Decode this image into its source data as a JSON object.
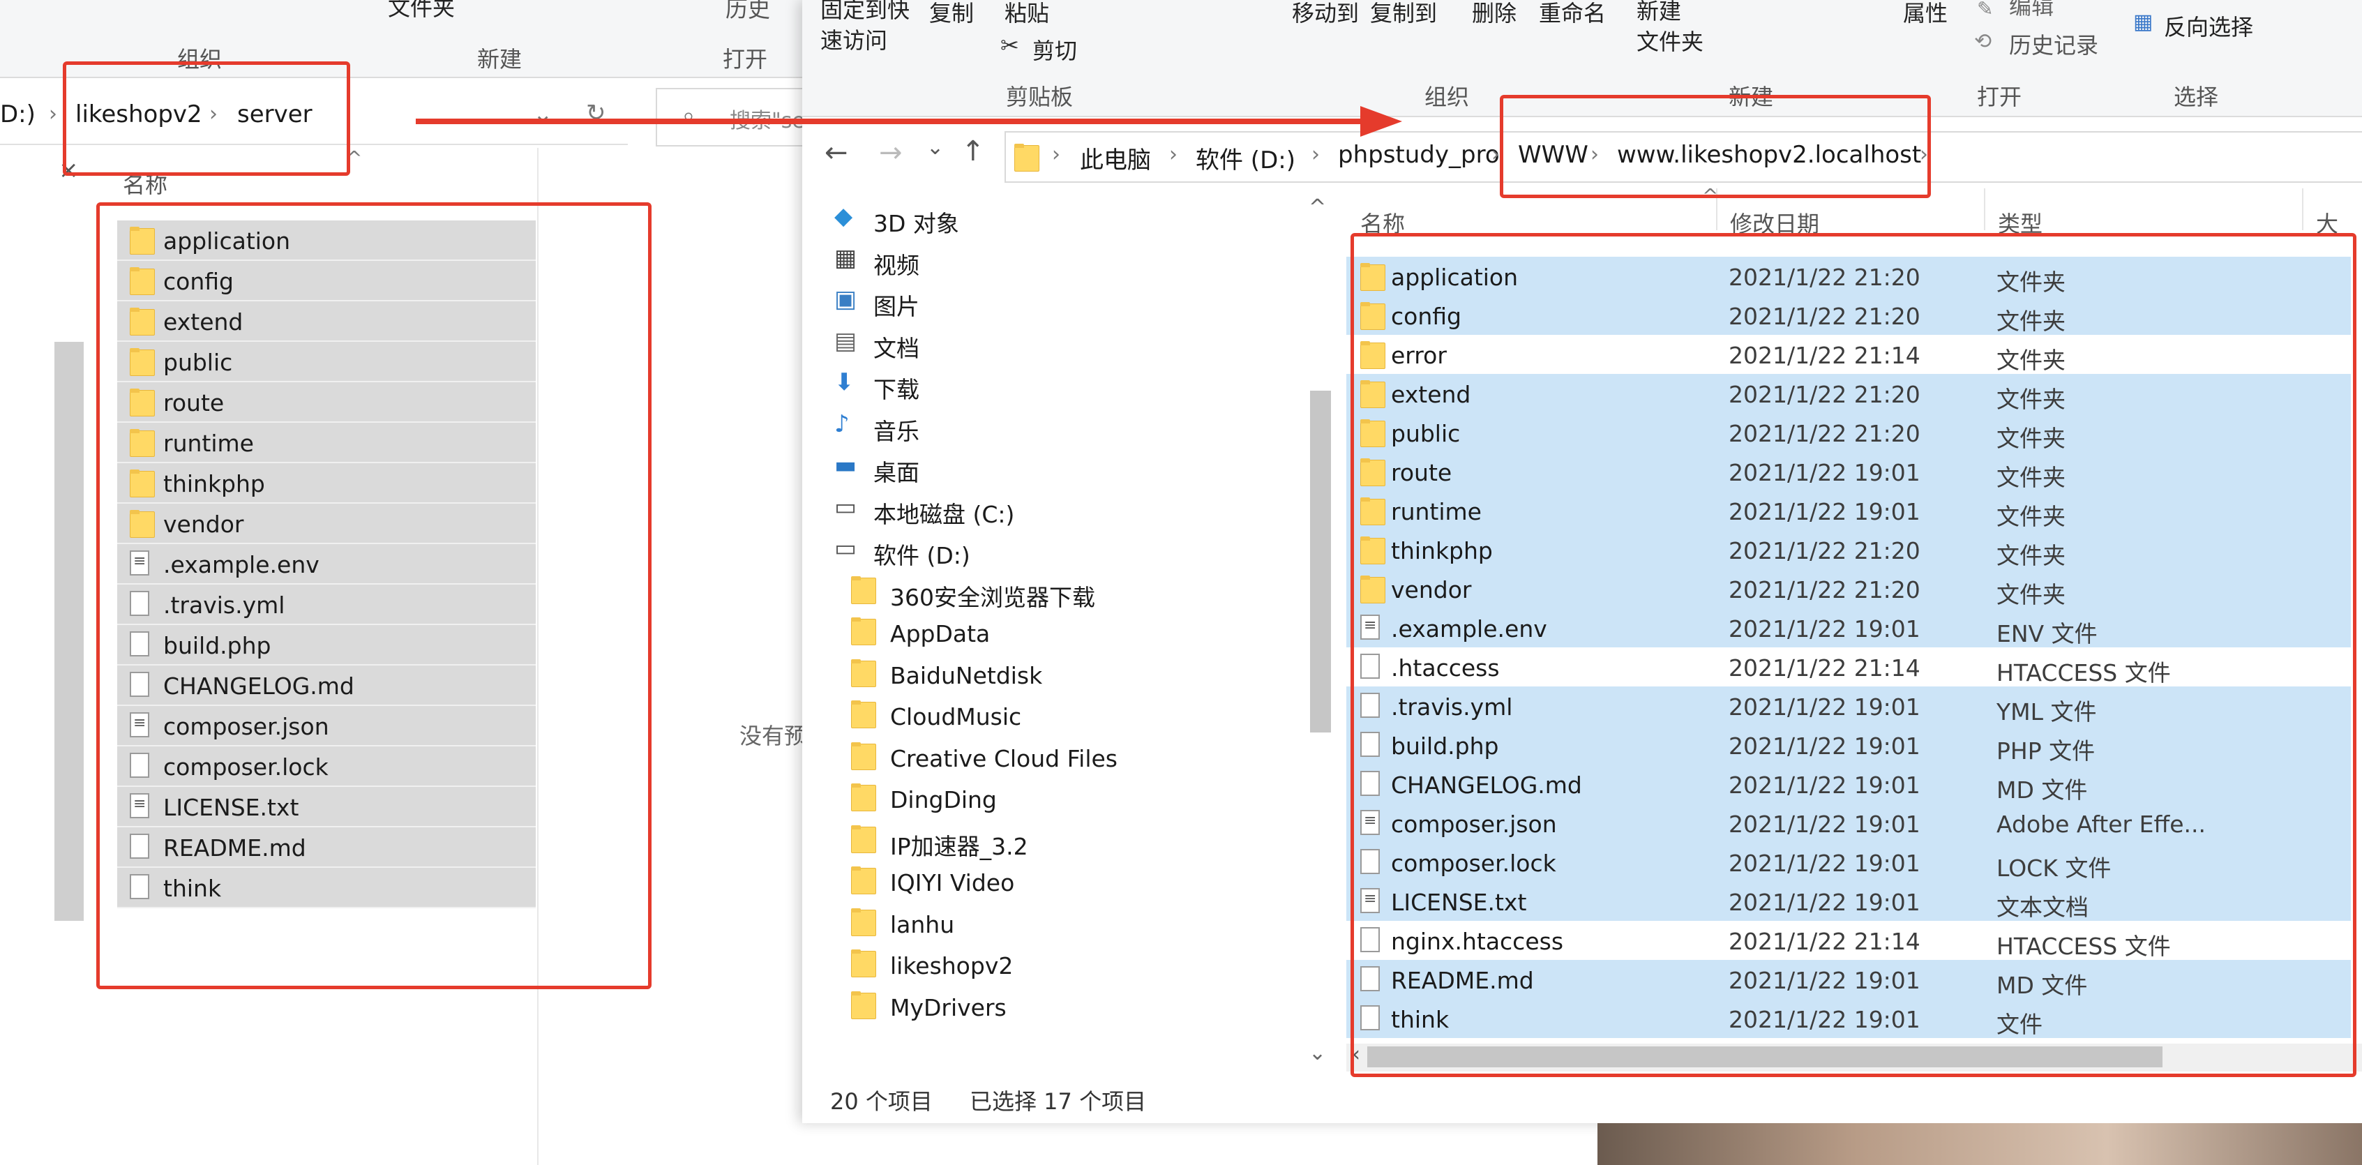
{
  "back_window": {
    "ribbon": {
      "top_cut_label": "文件夹",
      "top_cut_label2": "历史",
      "groups": [
        "组织",
        "新建",
        "打开"
      ]
    },
    "address": {
      "crumbs": [
        "D:)",
        "likeshopv2",
        "server"
      ],
      "search_placeholder": "搜索\"se"
    },
    "column_name": "名称",
    "no_preview": "没有预",
    "items": [
      {
        "name": "application",
        "icon": "folder-icon"
      },
      {
        "name": "config",
        "icon": "folder-icon"
      },
      {
        "name": "extend",
        "icon": "folder-icon"
      },
      {
        "name": "public",
        "icon": "folder-icon"
      },
      {
        "name": "route",
        "icon": "folder-icon"
      },
      {
        "name": "runtime",
        "icon": "folder-icon"
      },
      {
        "name": "thinkphp",
        "icon": "folder-icon"
      },
      {
        "name": "vendor",
        "icon": "folder-icon"
      },
      {
        "name": ".example.env",
        "icon": "settings-file-icon"
      },
      {
        "name": ".travis.yml",
        "icon": "file-icon"
      },
      {
        "name": "build.php",
        "icon": "file-icon"
      },
      {
        "name": "CHANGELOG.md",
        "icon": "file-icon"
      },
      {
        "name": "composer.json",
        "icon": "settings-file-icon"
      },
      {
        "name": "composer.lock",
        "icon": "file-icon"
      },
      {
        "name": "LICENSE.txt",
        "icon": "text-file-icon"
      },
      {
        "name": "README.md",
        "icon": "file-icon"
      },
      {
        "name": "think",
        "icon": "file-icon"
      }
    ]
  },
  "front_window": {
    "ribbon": {
      "pin": "固定到快\n速访问",
      "copy": "复制",
      "paste": "粘贴",
      "cut": "剪切",
      "clipboard_group": "剪贴板",
      "move_to": "移动到",
      "copy_to": "复制到",
      "delete": "删除",
      "rename": "重命名",
      "organize_group": "组织",
      "new_folder": "新建\n文件夹",
      "new_group": "新建",
      "properties": "属性",
      "edit": "编辑",
      "history": "历史记录",
      "open_group": "打开",
      "invert_select": "反向选择",
      "select_group": "选择"
    },
    "address": {
      "crumbs": [
        "此电脑",
        "软件 (D:)",
        "phpstudy_pro",
        "WWW",
        "www.likeshopv2.localhost"
      ]
    },
    "nav_pane": [
      {
        "label": "3D 对象",
        "icon": "3d-objects-icon",
        "indent": 0
      },
      {
        "label": "视频",
        "icon": "video-icon",
        "indent": 0
      },
      {
        "label": "图片",
        "icon": "pictures-icon",
        "indent": 0
      },
      {
        "label": "文档",
        "icon": "documents-icon",
        "indent": 0
      },
      {
        "label": "下载",
        "icon": "download-icon",
        "indent": 0
      },
      {
        "label": "音乐",
        "icon": "music-icon",
        "indent": 0
      },
      {
        "label": "桌面",
        "icon": "desktop-icon",
        "indent": 0
      },
      {
        "label": "本地磁盘 (C:)",
        "icon": "drive-icon",
        "indent": 0
      },
      {
        "label": "软件 (D:)",
        "icon": "drive-icon",
        "indent": 0
      },
      {
        "label": "360安全浏览器下载",
        "icon": "folder-icon",
        "indent": 1
      },
      {
        "label": "AppData",
        "icon": "folder-icon",
        "indent": 1
      },
      {
        "label": "BaiduNetdisk",
        "icon": "folder-icon",
        "indent": 1
      },
      {
        "label": "CloudMusic",
        "icon": "folder-icon",
        "indent": 1
      },
      {
        "label": "Creative Cloud Files",
        "icon": "folder-icon",
        "indent": 1
      },
      {
        "label": "DingDing",
        "icon": "folder-icon",
        "indent": 1
      },
      {
        "label": "IP加速器_3.2",
        "icon": "folder-icon",
        "indent": 1
      },
      {
        "label": "IQIYI Video",
        "icon": "folder-icon",
        "indent": 1
      },
      {
        "label": "lanhu",
        "icon": "folder-icon",
        "indent": 1
      },
      {
        "label": "likeshopv2",
        "icon": "folder-icon",
        "indent": 1
      },
      {
        "label": "MyDrivers",
        "icon": "folder-icon",
        "indent": 1
      }
    ],
    "columns": {
      "name": "名称",
      "modified": "修改日期",
      "type": "类型",
      "size": "大"
    },
    "files": [
      {
        "name": "application",
        "date": "2021/1/22 21:20",
        "type": "文件夹",
        "icon": "folder-icon",
        "selected": true
      },
      {
        "name": "config",
        "date": "2021/1/22 21:20",
        "type": "文件夹",
        "icon": "folder-icon",
        "selected": true
      },
      {
        "name": "error",
        "date": "2021/1/22 21:14",
        "type": "文件夹",
        "icon": "folder-icon",
        "selected": false
      },
      {
        "name": "extend",
        "date": "2021/1/22 21:20",
        "type": "文件夹",
        "icon": "folder-icon",
        "selected": true
      },
      {
        "name": "public",
        "date": "2021/1/22 21:20",
        "type": "文件夹",
        "icon": "folder-icon",
        "selected": true
      },
      {
        "name": "route",
        "date": "2021/1/22 19:01",
        "type": "文件夹",
        "icon": "folder-icon",
        "selected": true
      },
      {
        "name": "runtime",
        "date": "2021/1/22 19:01",
        "type": "文件夹",
        "icon": "folder-icon",
        "selected": true
      },
      {
        "name": "thinkphp",
        "date": "2021/1/22 21:20",
        "type": "文件夹",
        "icon": "folder-icon",
        "selected": true
      },
      {
        "name": "vendor",
        "date": "2021/1/22 21:20",
        "type": "文件夹",
        "icon": "folder-icon",
        "selected": true
      },
      {
        "name": ".example.env",
        "date": "2021/1/22 19:01",
        "type": "ENV 文件",
        "icon": "settings-file-icon",
        "selected": true
      },
      {
        "name": ".htaccess",
        "date": "2021/1/22 21:14",
        "type": "HTACCESS 文件",
        "icon": "file-icon",
        "selected": false
      },
      {
        "name": ".travis.yml",
        "date": "2021/1/22 19:01",
        "type": "YML 文件",
        "icon": "file-icon",
        "selected": true
      },
      {
        "name": "build.php",
        "date": "2021/1/22 19:01",
        "type": "PHP 文件",
        "icon": "file-icon",
        "selected": true
      },
      {
        "name": "CHANGELOG.md",
        "date": "2021/1/22 19:01",
        "type": "MD 文件",
        "icon": "file-icon",
        "selected": true
      },
      {
        "name": "composer.json",
        "date": "2021/1/22 19:01",
        "type": "Adobe After Effe...",
        "icon": "settings-file-icon",
        "selected": true
      },
      {
        "name": "composer.lock",
        "date": "2021/1/22 19:01",
        "type": "LOCK 文件",
        "icon": "file-icon",
        "selected": true
      },
      {
        "name": "LICENSE.txt",
        "date": "2021/1/22 19:01",
        "type": "文本文档",
        "icon": "text-file-icon",
        "selected": true
      },
      {
        "name": "nginx.htaccess",
        "date": "2021/1/22 21:14",
        "type": "HTACCESS 文件",
        "icon": "file-icon",
        "selected": false
      },
      {
        "name": "README.md",
        "date": "2021/1/22 19:01",
        "type": "MD 文件",
        "icon": "file-icon",
        "selected": true
      },
      {
        "name": "think",
        "date": "2021/1/22 19:01",
        "type": "文件",
        "icon": "file-icon",
        "selected": true
      }
    ],
    "status": {
      "count": "20 个项目",
      "selected": "已选择 17 个项目"
    }
  },
  "colors": {
    "annotation_red": "#e53b2c",
    "selection_blue": "#cce4f7",
    "back_selection_gray": "#dadada",
    "folder_yellow": "#ffd965"
  }
}
